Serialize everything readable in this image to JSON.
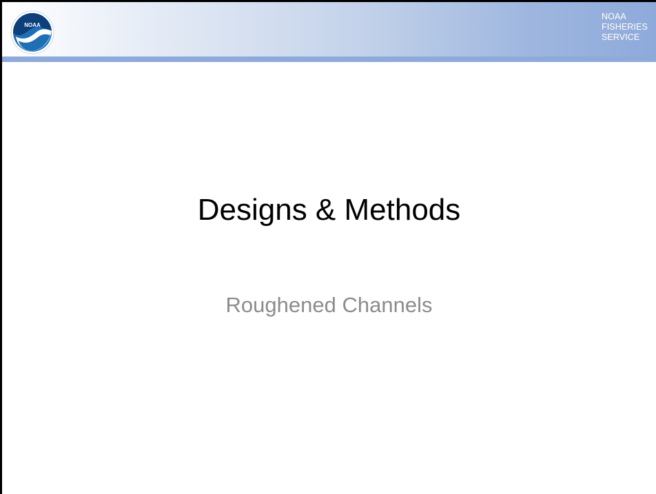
{
  "header": {
    "logo_text": "NOAA",
    "agency_lines": [
      "NOAA",
      "FISHERIES",
      "SERVICE"
    ]
  },
  "slide": {
    "title": "Designs & Methods",
    "subtitle": "Roughened Channels"
  },
  "colors": {
    "header_gradient_end": "#8eaadb",
    "header_rule": "#8eaadb",
    "logo_blue": "#1f6fb5",
    "title_text": "#000000",
    "subtitle_text": "#8c8c8c"
  },
  "icons": {
    "logo": "noaa-seal-icon"
  }
}
